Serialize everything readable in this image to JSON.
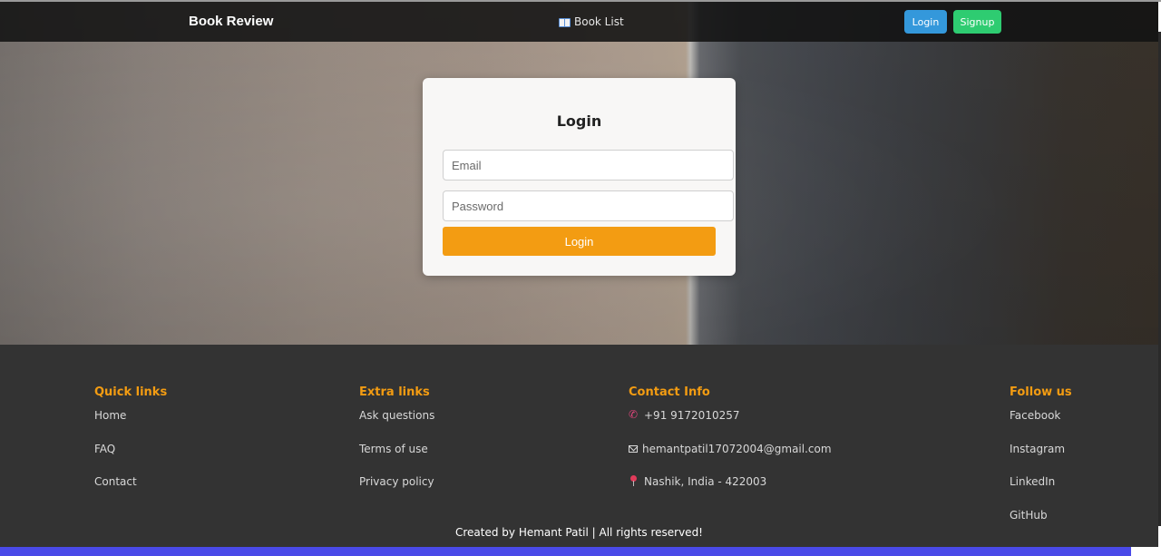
{
  "navbar": {
    "brand": "Book Review",
    "book_list_label": "Book List",
    "login_label": "Login",
    "signup_label": "Signup"
  },
  "login_form": {
    "title": "Login",
    "email_placeholder": "Email",
    "password_placeholder": "Password",
    "submit_label": "Login"
  },
  "footer": {
    "quick_links": {
      "heading": "Quick links",
      "items": [
        "Home",
        "FAQ",
        "Contact"
      ]
    },
    "extra_links": {
      "heading": "Extra links",
      "items": [
        "Ask questions",
        "Terms of use",
        "Privacy policy"
      ]
    },
    "contact_info": {
      "heading": "Contact Info",
      "phone": "+91 9172010257",
      "email": "hemantpatil17072004@gmail.com",
      "location": "Nashik, India - 422003"
    },
    "follow_us": {
      "heading": "Follow us",
      "items": [
        "Facebook",
        "Instagram",
        "LinkedIn",
        "GitHub"
      ]
    },
    "copyright": "Created by Hemant Patil | All rights reserved!"
  },
  "colors": {
    "accent_orange": "#f39c12",
    "login_blue": "#3498db",
    "signup_green": "#2ecc71",
    "footer_bg": "#333333"
  }
}
